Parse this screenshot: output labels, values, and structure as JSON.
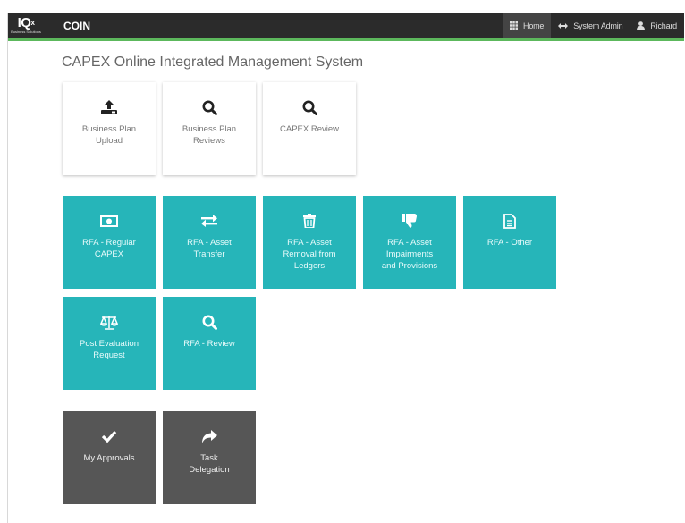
{
  "navbar": {
    "logo_mark": "IQ",
    "logo_sup": "x",
    "logo_sub": "Business Solutions",
    "brand": "COIN",
    "items": [
      {
        "label": "Home",
        "icon": "grid-icon",
        "active": true
      },
      {
        "label": "System Admin",
        "icon": "arrows-horizontal-icon",
        "active": false
      },
      {
        "label": "Richard",
        "icon": "user-icon",
        "active": false
      }
    ],
    "accent_color": "#5cb85c"
  },
  "page": {
    "title": "CAPEX Online Integrated Management System"
  },
  "tiles": {
    "upload": {
      "label": "Business Plan\nUpload",
      "icon": "upload-icon"
    },
    "plan_reviews": {
      "label": "Business Plan\nReviews",
      "icon": "search-icon"
    },
    "capex_review": {
      "label": "CAPEX Review",
      "icon": "search-icon"
    },
    "rfa_regular": {
      "label": "RFA - Regular\nCAPEX",
      "icon": "money-icon"
    },
    "rfa_transfer": {
      "label": "RFA - Asset\nTransfer",
      "icon": "exchange-icon"
    },
    "rfa_removal": {
      "label": "RFA - Asset\nRemoval from\nLedgers",
      "icon": "trash-icon"
    },
    "rfa_impairments": {
      "label": "RFA - Asset\nImpairments\nand Provisions",
      "icon": "thumbs-down-icon"
    },
    "rfa_other": {
      "label": "RFA - Other",
      "icon": "document-icon"
    },
    "post_eval": {
      "label": "Post Evaluation\nRequest",
      "icon": "balance-scale-icon"
    },
    "rfa_review": {
      "label": "RFA - Review",
      "icon": "search-icon"
    },
    "my_approvals": {
      "label": "My Approvals",
      "icon": "check-icon"
    },
    "task_delegation": {
      "label": "Task\nDelegation",
      "icon": "share-arrow-icon"
    }
  },
  "colors": {
    "teal": "#26b5b9",
    "dark": "#565656",
    "navbar_bg": "#2b2b2b"
  }
}
